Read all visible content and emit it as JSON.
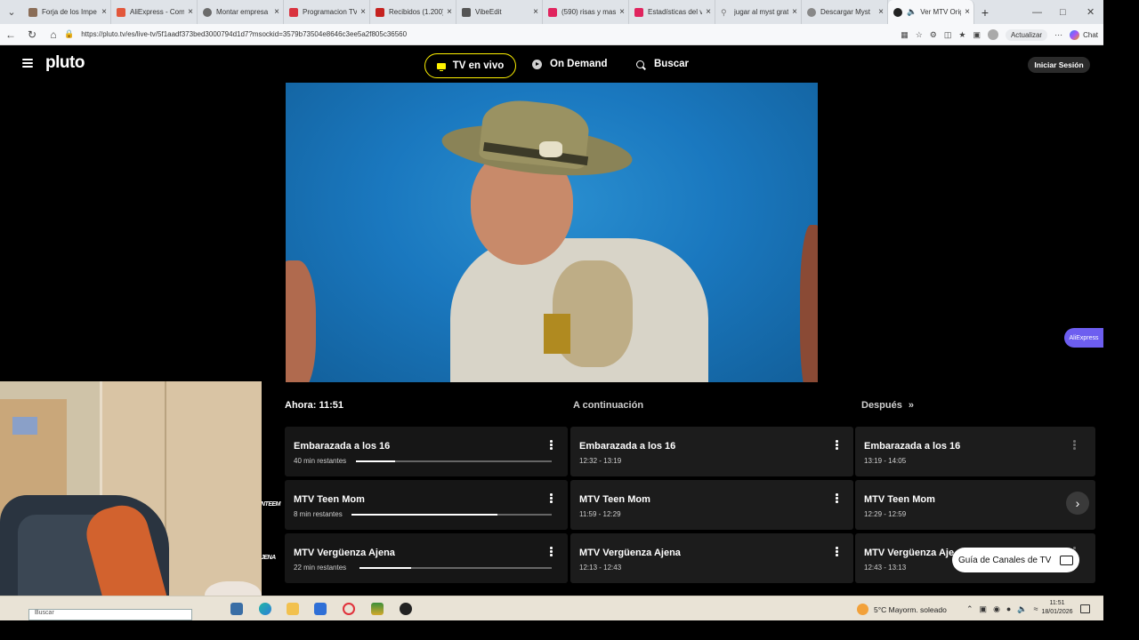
{
  "browser": {
    "tabs": [
      {
        "label": "Forja de los Impe",
        "favicon_color": "#8a6d57"
      },
      {
        "label": "AliExpress - Comp",
        "favicon_color": "#e2573b"
      },
      {
        "label": "Montar empresa",
        "favicon_color": "#6b6b6b"
      },
      {
        "label": "Programacion TV",
        "favicon_color": "#d9333f"
      },
      {
        "label": "Recibidos (1.200)",
        "favicon_color": "#c5221f"
      },
      {
        "label": "VibeEdit",
        "favicon_color": "#555555"
      },
      {
        "label": "(590) risas y mas",
        "favicon_color": "#e0245e"
      },
      {
        "label": "Estadísticas del v",
        "favicon_color": "#e0245e"
      },
      {
        "label": "jugar al myst grat",
        "favicon_color": "#777777"
      },
      {
        "label": "Descargar Myst",
        "favicon_color": "#888888"
      },
      {
        "label": "Ver MTV Orig",
        "favicon_color": "#222222"
      }
    ],
    "url": "https://pluto.tv/es/live-tv/5f1aadf373bed3000794d1d7?msockid=3579b73504e8646c3ee5a2f805c36560",
    "update_label": "Actualizar",
    "chat_label": "Chat"
  },
  "header": {
    "logo": "pluto",
    "nav_live": "TV en vivo",
    "nav_ondemand": "On Demand",
    "nav_search": "Buscar",
    "signin": "Iniciar Sesión"
  },
  "guide": {
    "now_label": "Ahora: 11:51",
    "next_label": "A continuación",
    "later_label": "Después",
    "rows": [
      {
        "channel_logo": "",
        "now": {
          "title": "Embarazada a los 16",
          "remaining": "40 min restantes",
          "progress": 0.2
        },
        "next": {
          "title": "Embarazada a los 16",
          "time": "12:32 - 13:19"
        },
        "later": {
          "title": "Embarazada a los 16",
          "time": "13:19 - 14:05"
        }
      },
      {
        "channel_logo": "NTEEM",
        "now": {
          "title": "MTV Teen Mom",
          "remaining": "8 min restantes",
          "progress": 0.73
        },
        "next": {
          "title": "MTV Teen Mom",
          "time": "11:59 - 12:29"
        },
        "later": {
          "title": "MTV Teen Mom",
          "time": "12:29 - 12:59"
        }
      },
      {
        "channel_logo": "JENA",
        "now": {
          "title": "MTV Vergüenza Ajena",
          "remaining": "22 min restantes",
          "progress": 0.27
        },
        "next": {
          "title": "MTV Vergüenza Ajena",
          "time": "12:13 - 12:43"
        },
        "later": {
          "title": "MTV Vergüenza Aje",
          "time": "12:43 - 13:13"
        }
      }
    ],
    "channel_guide_button": "Guía de Canales de TV",
    "aliexpress_badge": "AliExpress"
  },
  "taskbar": {
    "search_placeholder": "Buscar",
    "weather": "5°C  Mayorm. soleado",
    "time": "11:51",
    "date": "18/01/2026"
  },
  "colors": {
    "accent": "#fff200",
    "background": "#000000",
    "cell": "#1c1c1c"
  }
}
